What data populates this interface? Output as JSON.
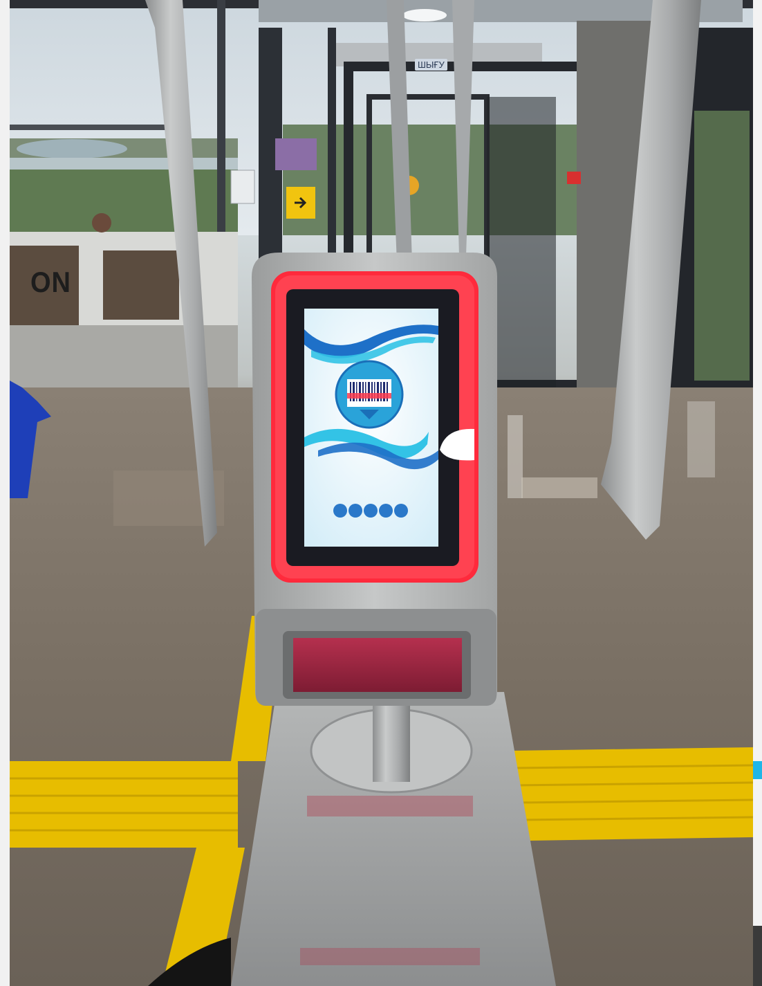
{
  "photo": {
    "description_colors": {
      "screen_glow": "#ff2a3c",
      "wave_blue": "#1e70c8",
      "wave_cyan": "#33c3e6",
      "tactile_yellow": "#f2c500",
      "steel": "#a9abab"
    },
    "background_sign_text": "ON",
    "door_badge_text": "ШЫҒУ"
  },
  "kiosk_screen": {
    "icon": "barcode-scan-icon",
    "progress_dots": 5
  }
}
